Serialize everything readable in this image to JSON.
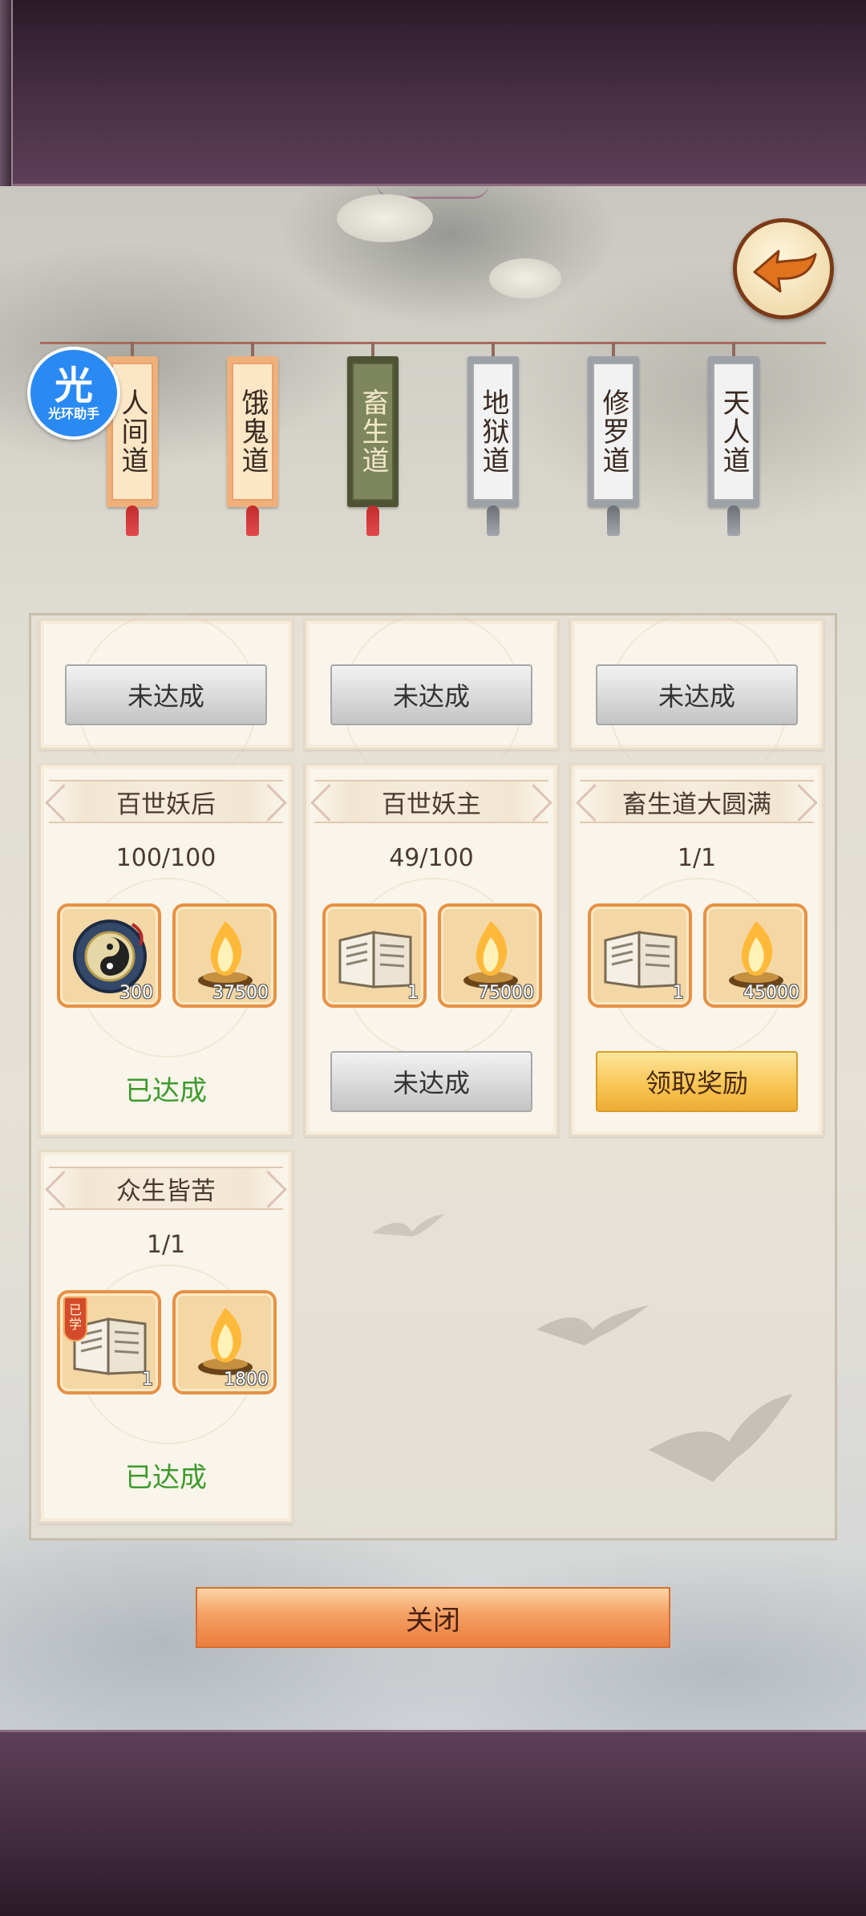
{
  "realm_tabs": [
    {
      "label": "人间道",
      "state": "unlocked"
    },
    {
      "label": "饿鬼道",
      "state": "unlocked"
    },
    {
      "label": "畜生道",
      "state": "selected"
    },
    {
      "label": "地狱道",
      "state": "locked"
    },
    {
      "label": "修罗道",
      "state": "locked"
    },
    {
      "label": "天人道",
      "state": "locked"
    }
  ],
  "badge": {
    "main": "光",
    "sub": "光环助手"
  },
  "top_row_cards": [
    {
      "button": "未达成"
    },
    {
      "button": "未达成"
    },
    {
      "button": "未达成"
    }
  ],
  "cards": [
    {
      "title": "百世妖后",
      "progress": "100/100",
      "items": [
        {
          "icon": "taiji-compass-icon",
          "count": "300"
        },
        {
          "icon": "spirit-flame-icon",
          "count": "37500"
        }
      ],
      "status": "已达成"
    },
    {
      "title": "百世妖主",
      "progress": "49/100",
      "items": [
        {
          "icon": "skill-book-icon",
          "count": "1"
        },
        {
          "icon": "spirit-flame-icon",
          "count": "75000"
        }
      ],
      "button": "未达成"
    },
    {
      "title": "畜生道大圆满",
      "progress": "1/1",
      "items": [
        {
          "icon": "skill-book-icon",
          "count": "1"
        },
        {
          "icon": "spirit-flame-icon",
          "count": "45000"
        }
      ],
      "button": "领取奖励"
    },
    {
      "title": "众生皆苦",
      "progress": "1/1",
      "items": [
        {
          "icon": "skill-book-icon",
          "count": "1",
          "tag": "已学"
        },
        {
          "icon": "spirit-flame-icon",
          "count": "1800"
        }
      ],
      "status": "已达成"
    }
  ],
  "close_label": "关闭",
  "colors": {
    "achieved_text": "#3c9b2c",
    "frame_purple": "#4a3044",
    "claim_button": "#f8c656",
    "close_button": "#f4a063"
  }
}
